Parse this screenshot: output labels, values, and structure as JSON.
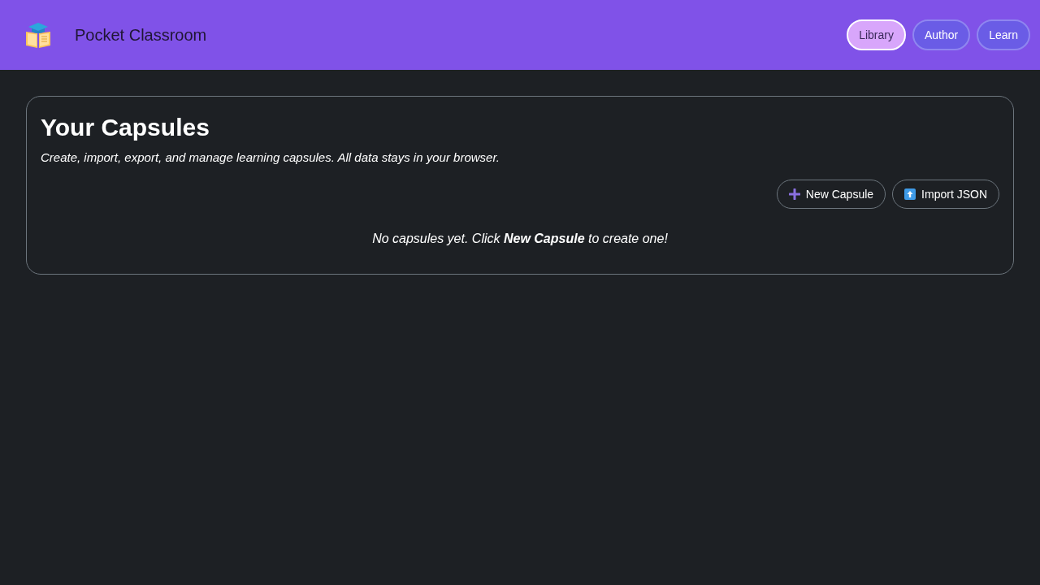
{
  "header": {
    "title": "Pocket Classroom",
    "nav": [
      {
        "label": "Library",
        "selected": true
      },
      {
        "label": "Author",
        "selected": false
      },
      {
        "label": "Learn",
        "selected": false
      }
    ]
  },
  "library": {
    "heading": "Your Capsules",
    "description": "Create, import, export, and manage learning capsules. All data stays in your browser.",
    "actions": [
      {
        "label": "New Capsule",
        "kind": "new"
      },
      {
        "label": "Import JSON",
        "kind": "import"
      }
    ],
    "empty_message": "No capsules yet. Click **New Capsule** to create one!"
  }
}
